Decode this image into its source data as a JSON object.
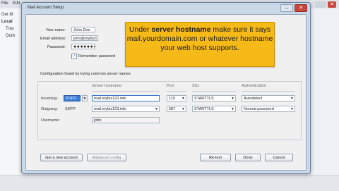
{
  "background": {
    "menu_items": [
      "File",
      "Edit"
    ],
    "sidebar_items": [
      "Get M",
      "Local",
      "Tras",
      "Outb"
    ]
  },
  "dialog": {
    "title": "Mail Account Setup",
    "minimize_glyph": "–",
    "close_glyph": "✕"
  },
  "tooltip": {
    "prefix": "Under ",
    "bold": "server hostname",
    "suffix": " make sure it says mail.yourdomain.com or whatever hostname your web host supports."
  },
  "form": {
    "name_label": "Your name:",
    "name_value": "John Doe",
    "email_label": "Email address:",
    "email_value": "john@mybiz1",
    "password_label": "Password:",
    "password_value": "●●●●●●●●",
    "remember_label": "Remember password",
    "remember_checked": "✓"
  },
  "config_message": "Configuration found by trying common server names",
  "server_table": {
    "headers": {
      "hostname": "Server hostname",
      "port": "Port",
      "ssl": "SSL",
      "auth": "Authentication"
    },
    "incoming": {
      "label": "Incoming:",
      "protocol": "POP3",
      "hostname": "mail.mybiz123.info",
      "port": "110",
      "ssl": "STARTTLS",
      "auth": "Autodetect"
    },
    "outgoing": {
      "label": "Outgoing:",
      "protocol": "SMTP",
      "hostname": "mail.mybiz123.info",
      "port": "587",
      "ssl": "STARTTLS",
      "auth": "Normal password"
    },
    "username": {
      "label": "Username:",
      "value": "john"
    }
  },
  "buttons": {
    "get_account": "Get a new account",
    "advanced": "Advanced config",
    "retest": "Re-test",
    "done": "Done",
    "cancel": "Cancel"
  }
}
